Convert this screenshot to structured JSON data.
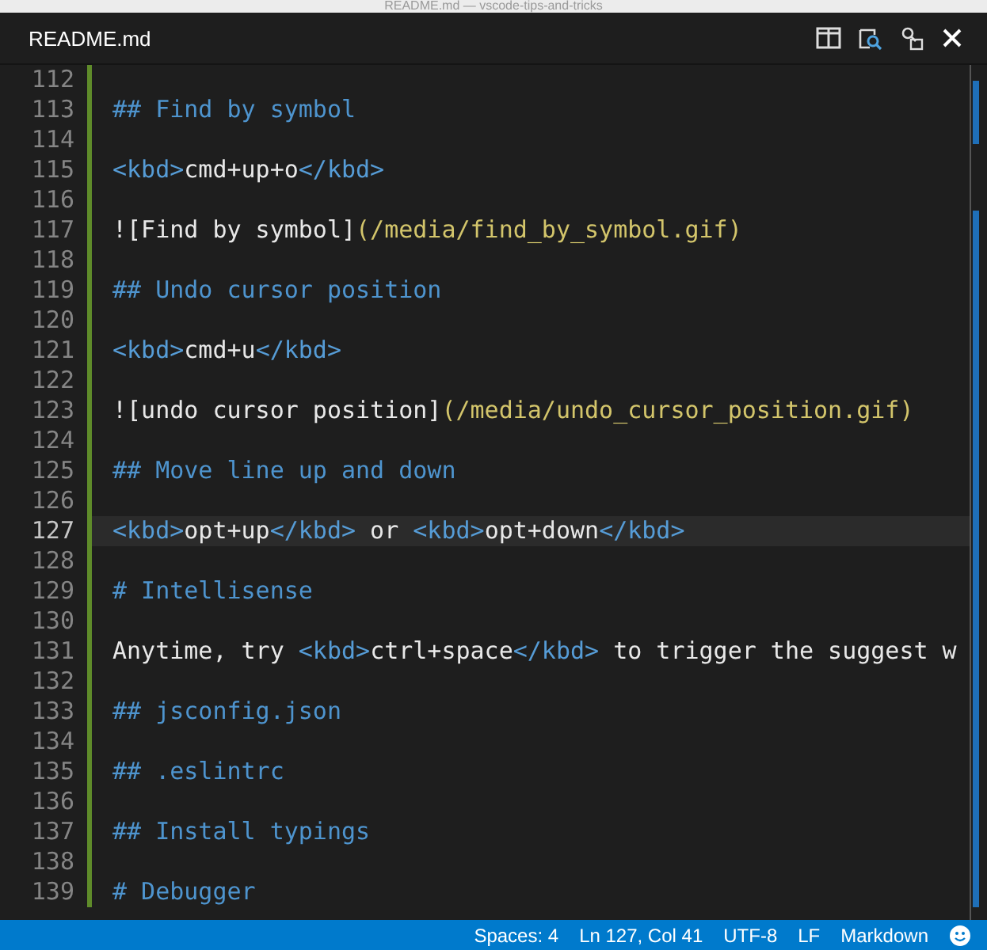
{
  "window": {
    "title": "README.md — vscode-tips-and-tricks"
  },
  "tab": {
    "label": "README.md"
  },
  "lines": [
    {
      "number": "112",
      "current": false
    },
    {
      "number": "113",
      "current": false,
      "tokens": [
        {
          "kind": "heading",
          "text": "## Find by symbol"
        }
      ]
    },
    {
      "number": "114",
      "current": false
    },
    {
      "number": "115",
      "current": false,
      "tokens": [
        {
          "kind": "tag",
          "text": "<kbd>"
        },
        {
          "kind": "text",
          "text": "cmd+up+o"
        },
        {
          "kind": "tag",
          "text": "</kbd>"
        }
      ]
    },
    {
      "number": "116",
      "current": false
    },
    {
      "number": "117",
      "current": false,
      "tokens": [
        {
          "kind": "link",
          "text": "![Find by symbol]"
        },
        {
          "kind": "url",
          "text": "(/media/find_by_symbol.gif)"
        }
      ]
    },
    {
      "number": "118",
      "current": false
    },
    {
      "number": "119",
      "current": false,
      "tokens": [
        {
          "kind": "heading",
          "text": "## Undo cursor position"
        }
      ]
    },
    {
      "number": "120",
      "current": false
    },
    {
      "number": "121",
      "current": false,
      "tokens": [
        {
          "kind": "tag",
          "text": "<kbd>"
        },
        {
          "kind": "text",
          "text": "cmd+u"
        },
        {
          "kind": "tag",
          "text": "</kbd>"
        }
      ]
    },
    {
      "number": "122",
      "current": false
    },
    {
      "number": "123",
      "current": false,
      "tokens": [
        {
          "kind": "link",
          "text": "![undo cursor position]"
        },
        {
          "kind": "url",
          "text": "(/media/undo_cursor_position.gif)"
        }
      ]
    },
    {
      "number": "124",
      "current": false
    },
    {
      "number": "125",
      "current": false,
      "tokens": [
        {
          "kind": "heading",
          "text": "## Move line up and down"
        }
      ]
    },
    {
      "number": "126",
      "current": false
    },
    {
      "number": "127",
      "current": true,
      "tokens": [
        {
          "kind": "tag",
          "text": "<kbd>"
        },
        {
          "kind": "text",
          "text": "opt+up"
        },
        {
          "kind": "tag",
          "text": "</kbd>"
        },
        {
          "kind": "text",
          "text": " or "
        },
        {
          "kind": "tag",
          "text": "<kbd>"
        },
        {
          "kind": "text",
          "text": "opt+down"
        },
        {
          "kind": "tag",
          "text": "</kbd>"
        }
      ]
    },
    {
      "number": "128",
      "current": false
    },
    {
      "number": "129",
      "current": false,
      "tokens": [
        {
          "kind": "heading",
          "text": "# Intellisense"
        }
      ]
    },
    {
      "number": "130",
      "current": false
    },
    {
      "number": "131",
      "current": false,
      "tokens": [
        {
          "kind": "text",
          "text": "Anytime, try "
        },
        {
          "kind": "tag",
          "text": "<kbd>"
        },
        {
          "kind": "text",
          "text": "ctrl+space"
        },
        {
          "kind": "tag",
          "text": "</kbd>"
        },
        {
          "kind": "text",
          "text": " to trigger the suggest w"
        }
      ]
    },
    {
      "number": "132",
      "current": false
    },
    {
      "number": "133",
      "current": false,
      "tokens": [
        {
          "kind": "heading",
          "text": "## jsconfig.json"
        }
      ]
    },
    {
      "number": "134",
      "current": false
    },
    {
      "number": "135",
      "current": false,
      "tokens": [
        {
          "kind": "heading",
          "text": "## .eslintrc"
        }
      ]
    },
    {
      "number": "136",
      "current": false
    },
    {
      "number": "137",
      "current": false,
      "tokens": [
        {
          "kind": "heading",
          "text": "## Install typings"
        }
      ]
    },
    {
      "number": "138",
      "current": false
    },
    {
      "number": "139",
      "current": false,
      "tokens": [
        {
          "kind": "heading",
          "text": "# Debugger"
        }
      ]
    }
  ],
  "status_bar": {
    "items": [
      "Spaces: 4",
      "Ln 127, Col 41",
      "UTF-8",
      "LF",
      "Markdown"
    ]
  }
}
